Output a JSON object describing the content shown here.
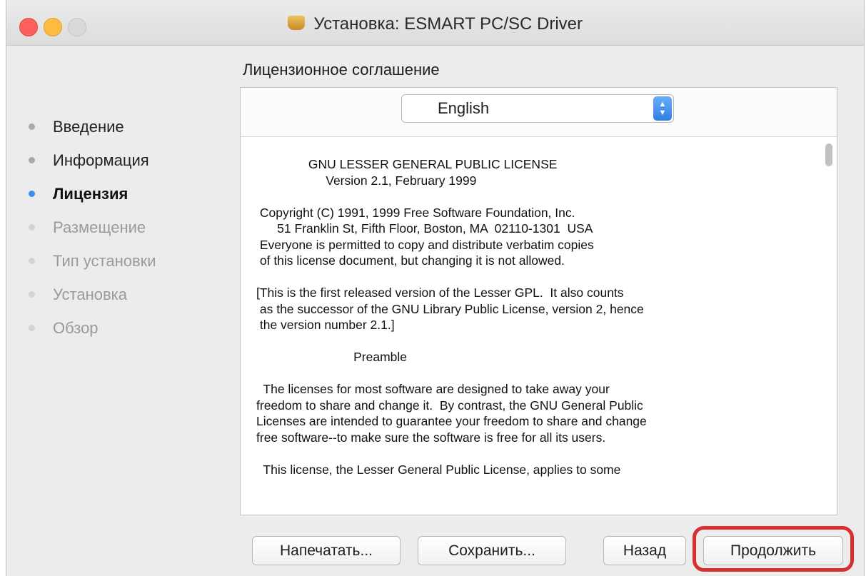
{
  "window": {
    "title": "Установка: ESMART PC/SC Driver"
  },
  "section_title": "Лицензионное соглашение",
  "steps": [
    {
      "label": "Введение",
      "state": "done"
    },
    {
      "label": "Информация",
      "state": "done"
    },
    {
      "label": "Лицензия",
      "state": "active"
    },
    {
      "label": "Размещение",
      "state": "future"
    },
    {
      "label": "Тип установки",
      "state": "future"
    },
    {
      "label": "Установка",
      "state": "future"
    },
    {
      "label": "Обзор",
      "state": "future"
    }
  ],
  "language": {
    "selected": "English"
  },
  "license_lines": [
    "               GNU LESSER GENERAL PUBLIC LICENSE",
    "                    Version 2.1, February 1999",
    "",
    " Copyright (C) 1991, 1999 Free Software Foundation, Inc.",
    "      51 Franklin St, Fifth Floor, Boston, MA  02110-1301  USA",
    " Everyone is permitted to copy and distribute verbatim copies",
    " of this license document, but changing it is not allowed.",
    "",
    "[This is the first released version of the Lesser GPL.  It also counts",
    " as the successor of the GNU Library Public License, version 2, hence",
    " the version number 2.1.]",
    "",
    "                            Preamble",
    "",
    "  The licenses for most software are designed to take away your",
    "freedom to share and change it.  By contrast, the GNU General Public",
    "Licenses are intended to guarantee your freedom to share and change",
    "free software--to make sure the software is free for all its users.",
    "",
    "  This license, the Lesser General Public License, applies to some"
  ],
  "buttons": {
    "print": "Напечатать...",
    "save": "Сохранить...",
    "back": "Назад",
    "continue": "Продолжить"
  },
  "colors": {
    "active_dot": "#3b8ff0",
    "highlight": "#d63031",
    "close": "#fc605c",
    "minimize": "#fdbc40"
  }
}
